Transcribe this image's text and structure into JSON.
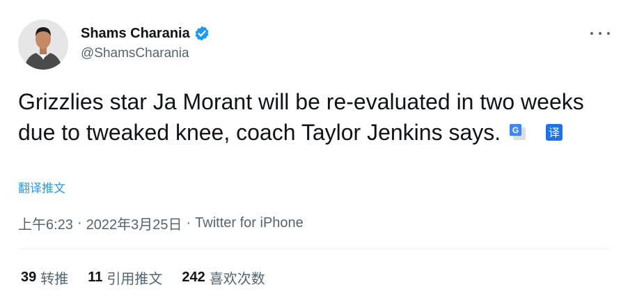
{
  "author": {
    "display_name": "Shams Charania",
    "handle": "@ShamsCharania",
    "avatar_icon": "avatar-photo",
    "verified_icon": "verified-badge-icon"
  },
  "tweet": {
    "text": "Grizzlies star Ja Morant will be re-evaluated in two weeks due to tweaked knee, coach Taylor Jenkins says.",
    "translate_link": "翻译推文"
  },
  "meta": {
    "time": "上午6:23",
    "date": "2022年3月25日",
    "source": "Twitter for iPhone",
    "separator": "·"
  },
  "stats": {
    "retweets_count": "39",
    "retweets_label": "转推",
    "quotes_count": "11",
    "quotes_label": "引用推文",
    "likes_count": "242",
    "likes_label": "喜欢次数"
  },
  "colors": {
    "accent": "#1d9bf0",
    "text": "#0f1419",
    "secondary": "#536471",
    "divider": "#eff3f4"
  }
}
